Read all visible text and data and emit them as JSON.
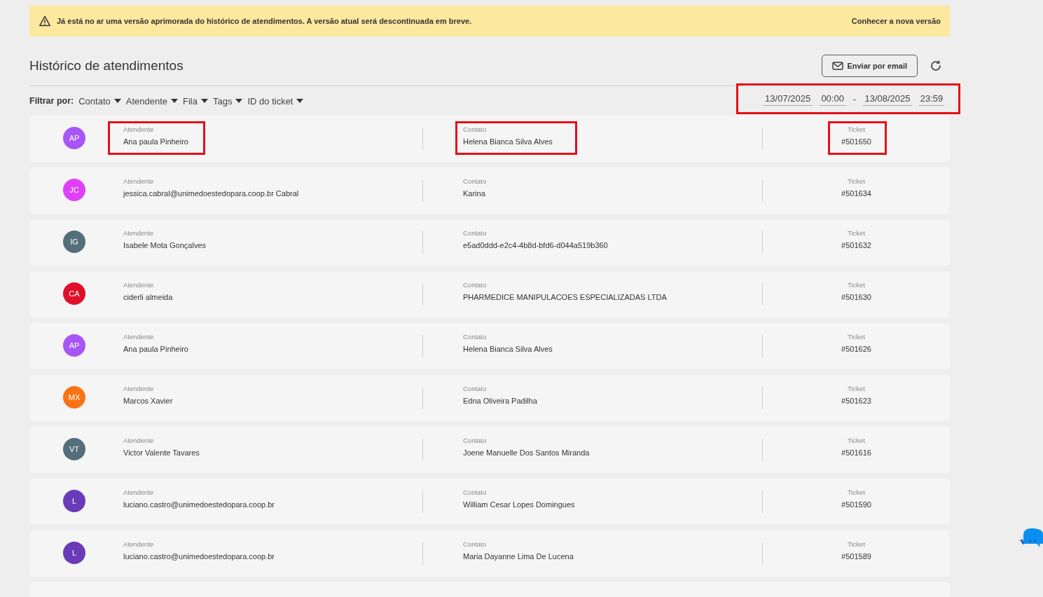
{
  "banner": {
    "message": "Já está no ar uma versão aprimorada do histórico de atendimentos. A versão atual será descontinuada em breve.",
    "link": "Conhecer a nova versão"
  },
  "title": "Histórico de atendimentos",
  "email_button": "Enviar por email",
  "filter": {
    "label": "Filtrar por:",
    "options": [
      "Contato",
      "Atendente",
      "Fila",
      "Tags",
      "ID do ticket"
    ]
  },
  "date_range": {
    "highlighted": true,
    "start_date": "13/07/2025",
    "start_time": "00:00",
    "separator": "-",
    "end_date": "13/08/2025",
    "end_time": "23:59"
  },
  "rows": [
    {
      "initials": "AP",
      "color": "#a855f7",
      "agent_label": "Atendente",
      "agent": "Ana paula Pinheiro",
      "contact_label": "Contato",
      "contact": "Helena Bianca Silva Alves",
      "ticket_label": "Ticket",
      "ticket": "#501650",
      "highlighted": true
    },
    {
      "initials": "JC",
      "color": "#e040fb",
      "agent_label": "Atendente",
      "agent": "jessica.cabral@unimedoestedopara.coop.br Cabral",
      "contact_label": "Contato",
      "contact": "Karina",
      "ticket_label": "Ticket",
      "ticket": "#501634",
      "highlighted": false
    },
    {
      "initials": "IG",
      "color": "#546e7a",
      "agent_label": "Atendente",
      "agent": "Isabele Mota Gonçalves",
      "contact_label": "Contato",
      "contact": "e5ad0ddd-e2c4-4b8d-bfd6-d044a519b360",
      "ticket_label": "Ticket",
      "ticket": "#501632",
      "highlighted": false
    },
    {
      "initials": "CA",
      "color": "#e0102a",
      "agent_label": "Atendente",
      "agent": "ciderli almeida",
      "contact_label": "Contato",
      "contact": "PHARMEDICE MANIPULACOES ESPECIALIZADAS LTDA",
      "ticket_label": "Ticket",
      "ticket": "#501630",
      "highlighted": false
    },
    {
      "initials": "AP",
      "color": "#a855f7",
      "agent_label": "Atendente",
      "agent": "Ana paula Pinheiro",
      "contact_label": "Contato",
      "contact": "Helena Bianca Silva Alves",
      "ticket_label": "Ticket",
      "ticket": "#501626",
      "highlighted": false
    },
    {
      "initials": "MX",
      "color": "#f97316",
      "agent_label": "Atendente",
      "agent": "Marcos Xavier",
      "contact_label": "Contato",
      "contact": "Edna Oliveira Padilha",
      "ticket_label": "Ticket",
      "ticket": "#501623",
      "highlighted": false
    },
    {
      "initials": "VT",
      "color": "#546e7a",
      "agent_label": "Atendente",
      "agent": "Victor Valente Tavares",
      "contact_label": "Contato",
      "contact": "Joene Manuelle Dos Santos Miranda",
      "ticket_label": "Ticket",
      "ticket": "#501616",
      "highlighted": false
    },
    {
      "initials": "L",
      "color": "#6a3bb8",
      "agent_label": "Atendente",
      "agent": "luciano.castro@unimedoestedopara.coop.br",
      "contact_label": "Contato",
      "contact": "William Cesar Lopes Domingues",
      "ticket_label": "Ticket",
      "ticket": "#501590",
      "highlighted": false
    },
    {
      "initials": "L",
      "color": "#6a3bb8",
      "agent_label": "Atendente",
      "agent": "luciano.castro@unimedoestedopara.coop.br",
      "contact_label": "Contato",
      "contact": "Maria Dayanne Lima De Lucena",
      "ticket_label": "Ticket",
      "ticket": "#501589",
      "highlighted": false
    }
  ]
}
